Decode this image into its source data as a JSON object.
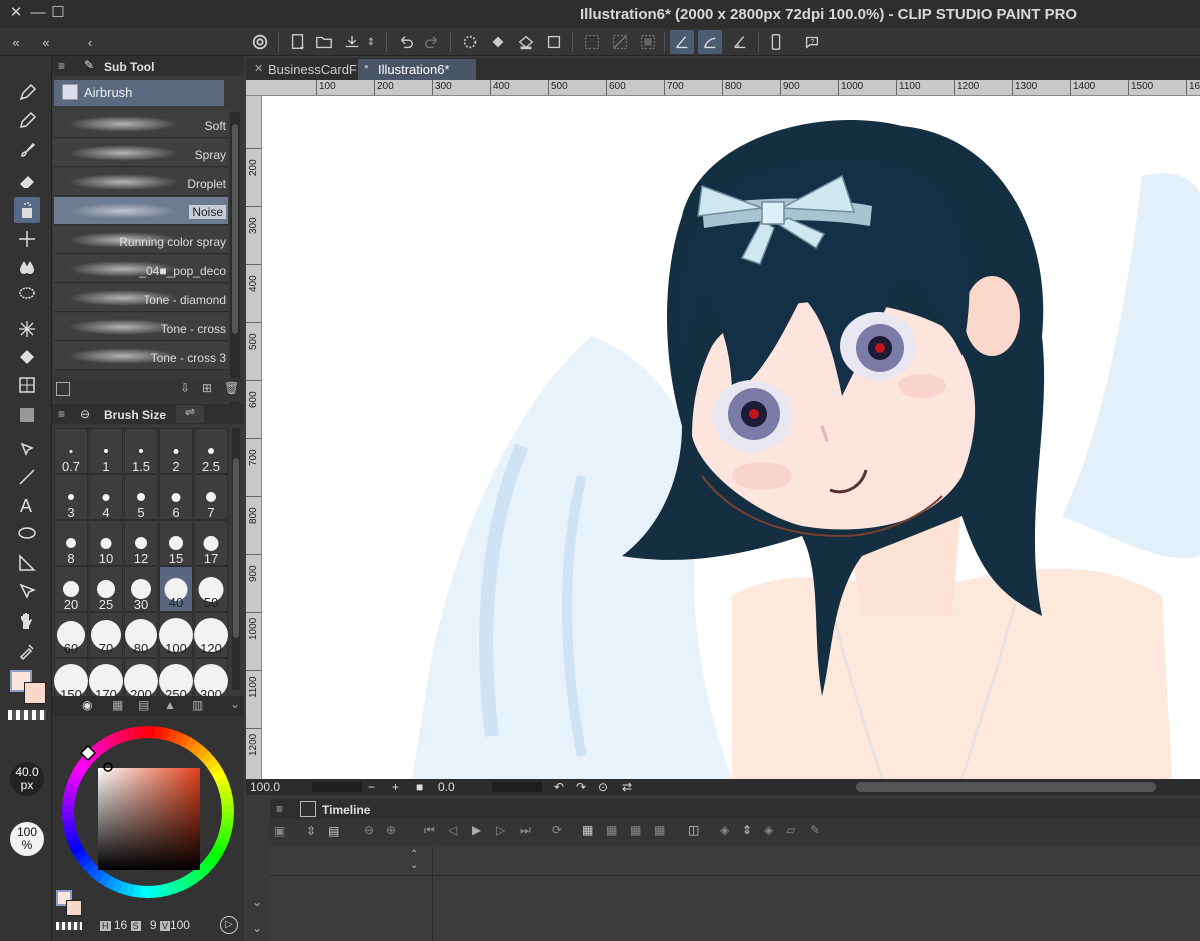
{
  "window": {
    "title": "Illustration6* (2000 x 2800px 72dpi 100.0%)  - CLIP STUDIO PAINT PRO"
  },
  "subtool": {
    "tab_label": "Sub Tool",
    "group": "Airbrush",
    "brushes": [
      {
        "label": "Soft",
        "selected": false
      },
      {
        "label": "Spray",
        "selected": false
      },
      {
        "label": "Droplet",
        "selected": false
      },
      {
        "label": "Noise",
        "selected": true
      },
      {
        "label": "Running color spray",
        "selected": false
      },
      {
        "label": "_04■_pop_deco",
        "selected": false
      },
      {
        "label": "Tone - diamond",
        "selected": false
      },
      {
        "label": "Tone - cross",
        "selected": false
      },
      {
        "label": "Tone - cross 3",
        "selected": false
      }
    ]
  },
  "brush_size": {
    "tab_label": "Brush Size",
    "sizes": [
      "0.7",
      "1",
      "1.5",
      "2",
      "2.5",
      "3",
      "4",
      "5",
      "6",
      "7",
      "8",
      "10",
      "12",
      "15",
      "17",
      "20",
      "25",
      "30",
      "40",
      "50",
      "60",
      "70",
      "80",
      "100",
      "120",
      "150",
      "170",
      "200",
      "250",
      "300"
    ],
    "selected": "40"
  },
  "tool_property": {
    "size_value": "40.0",
    "size_unit": "px",
    "opacity_value": "100",
    "opacity_unit": "%"
  },
  "color": {
    "main": "#fbe4dc",
    "sub": "#f8d8c8",
    "hsv_h_label": "H",
    "hsv_h": "16",
    "hsv_s_label": "S",
    "hsv_s": "9",
    "hsv_v_label": "V",
    "hsv_v": "100"
  },
  "documents": {
    "tabs": [
      {
        "label": "BusinessCardF",
        "active": false
      },
      {
        "label": "Illustration6*",
        "active": true
      }
    ]
  },
  "ruler": {
    "h_labels": [
      "100",
      "200",
      "300",
      "400",
      "500",
      "600",
      "700",
      "800",
      "900",
      "1000",
      "1100",
      "1200",
      "1300",
      "1400",
      "1500",
      "16"
    ],
    "v_labels": [
      "200",
      "300",
      "400",
      "500",
      "600",
      "700",
      "800",
      "900",
      "1000",
      "1100",
      "1200"
    ]
  },
  "status": {
    "zoom": "100.0",
    "rotation": "0.0"
  },
  "timeline": {
    "title": "Timeline"
  }
}
